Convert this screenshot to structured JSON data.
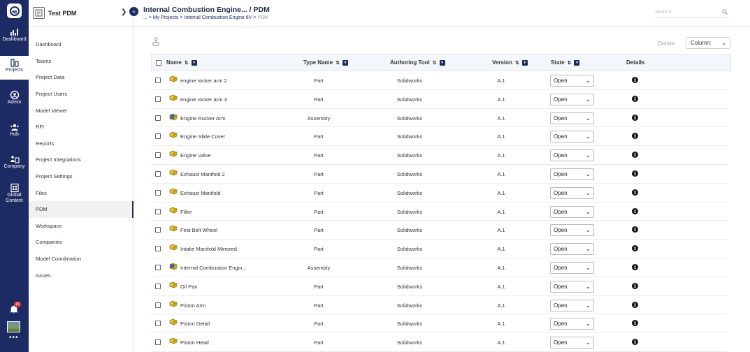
{
  "rail": {
    "items": [
      {
        "label": "Dashboard",
        "icon": "dashboard-icon"
      },
      {
        "label": "Projects",
        "icon": "projects-icon"
      },
      {
        "label": "Admin",
        "icon": "admin-icon"
      },
      {
        "label": "Hub",
        "icon": "hub-icon"
      },
      {
        "label": "Company",
        "icon": "company-icon"
      },
      {
        "label": "Global Content",
        "icon": "global-content-icon"
      }
    ],
    "notification_count": "13",
    "more": "•••"
  },
  "sidebar": {
    "project_name": "Test PDM",
    "items": [
      {
        "label": "Dashboard"
      },
      {
        "label": "Teams"
      },
      {
        "label": "Project Data"
      },
      {
        "label": "Project Users"
      },
      {
        "label": "Model Viewer"
      },
      {
        "label": "RFI"
      },
      {
        "label": "Reports"
      },
      {
        "label": "Project Integrations"
      },
      {
        "label": "Project Settings"
      },
      {
        "label": "Files"
      },
      {
        "label": "PDM"
      },
      {
        "label": "Workspace"
      },
      {
        "label": "Companies"
      },
      {
        "label": "Model Coordination"
      },
      {
        "label": "Issues"
      }
    ],
    "active_label": "PDM"
  },
  "header": {
    "title": "Internal Combustion Engine...  / PDM",
    "breadcrumb": [
      "...",
      "My Projects",
      "Internal Combustion Engine 6V",
      "PDM"
    ],
    "search_placeholder": "Search"
  },
  "toolbar": {
    "delete_label": "Delete",
    "columns_label": "Column: "
  },
  "table": {
    "columns": [
      "Name",
      "Type Name",
      "Authoring Tool",
      "Version",
      "State",
      "Details"
    ],
    "rows": [
      {
        "name": "engine rocker arm 2",
        "type": "Part",
        "tool": "Solidworks",
        "version": "A.1",
        "state": "Open"
      },
      {
        "name": "engine rocker arm 3",
        "type": "Part",
        "tool": "Solidworks",
        "version": "A.1",
        "state": "Open"
      },
      {
        "name": "Engine Rocker Arm",
        "type": "Assembly",
        "tool": "Solidworks",
        "version": "A.1",
        "state": "Open"
      },
      {
        "name": "Engine Slide Cover",
        "type": "Part",
        "tool": "Solidworks",
        "version": "A.1",
        "state": "Open"
      },
      {
        "name": "Engine Valve",
        "type": "Part",
        "tool": "Solidworks",
        "version": "A.1",
        "state": "Open"
      },
      {
        "name": "Exhaust Manifold 2",
        "type": "Part",
        "tool": "Solidworks",
        "version": "A.1",
        "state": "Open"
      },
      {
        "name": "Exhaust Manifold",
        "type": "Part",
        "tool": "Solidworks",
        "version": "A.1",
        "state": "Open"
      },
      {
        "name": "Filter",
        "type": "Part",
        "tool": "Solidworks",
        "version": "A.1",
        "state": "Open"
      },
      {
        "name": "First Belt Wheel",
        "type": "Part",
        "tool": "Solidworks",
        "version": "A.1",
        "state": "Open"
      },
      {
        "name": "Intake Manifold Mirrored",
        "type": "Part",
        "tool": "Solidworks",
        "version": "A.1",
        "state": "Open"
      },
      {
        "name": "Internal Combustion Engin...",
        "type": "Assembly",
        "tool": "Solidworks",
        "version": "A.1",
        "state": "Open"
      },
      {
        "name": "Oil Pan",
        "type": "Part",
        "tool": "Solidworks",
        "version": "A.1",
        "state": "Open"
      },
      {
        "name": "Piston Arm",
        "type": "Part",
        "tool": "Solidworks",
        "version": "A.1",
        "state": "Open"
      },
      {
        "name": "Piston Detail",
        "type": "Part",
        "tool": "Solidworks",
        "version": "A.1",
        "state": "Open"
      },
      {
        "name": "Piston Head",
        "type": "Part",
        "tool": "Solidworks",
        "version": "A.1",
        "state": "Open"
      }
    ]
  },
  "colors": {
    "navy": "#1c2b63",
    "part_icon": "#e0b320",
    "assembly_icon": "#2f6fbf"
  }
}
